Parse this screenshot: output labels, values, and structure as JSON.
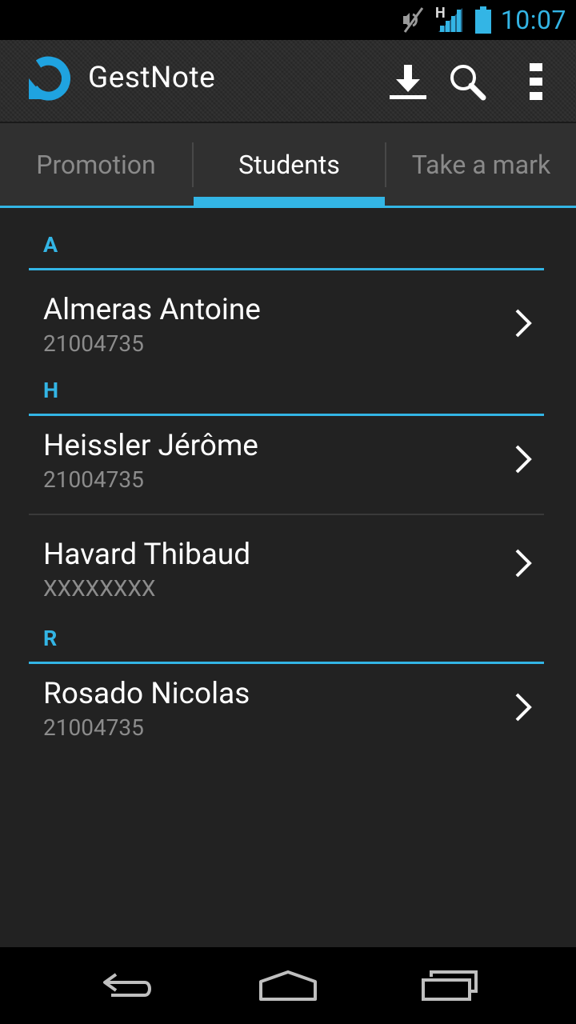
{
  "colors": {
    "accent": "#33b5e5",
    "background": "#222222",
    "secondary_text": "#8c8c8c"
  },
  "status_bar": {
    "time": "10:07",
    "network_label": "H"
  },
  "action_bar": {
    "title": "GestNote",
    "icons": [
      "app-logo",
      "download-icon",
      "search-icon",
      "overflow-menu-icon"
    ]
  },
  "tabs": [
    {
      "label": "Promotion",
      "active": false
    },
    {
      "label": "Students",
      "active": true
    },
    {
      "label": "Take a mark",
      "active": false
    }
  ],
  "sections": [
    {
      "letter": "A",
      "students": [
        {
          "name": "Almeras Antoine",
          "id": "21004735"
        }
      ]
    },
    {
      "letter": "H",
      "students": [
        {
          "name": "Heissler Jérôme",
          "id": "21004735"
        },
        {
          "name": "Havard Thibaud",
          "id": "XXXXXXXX"
        }
      ]
    },
    {
      "letter": "R",
      "students": [
        {
          "name": "Rosado Nicolas",
          "id": "21004735"
        }
      ]
    }
  ],
  "nav_bar": {
    "icons": [
      "back-icon",
      "home-icon",
      "recent-apps-icon"
    ]
  }
}
